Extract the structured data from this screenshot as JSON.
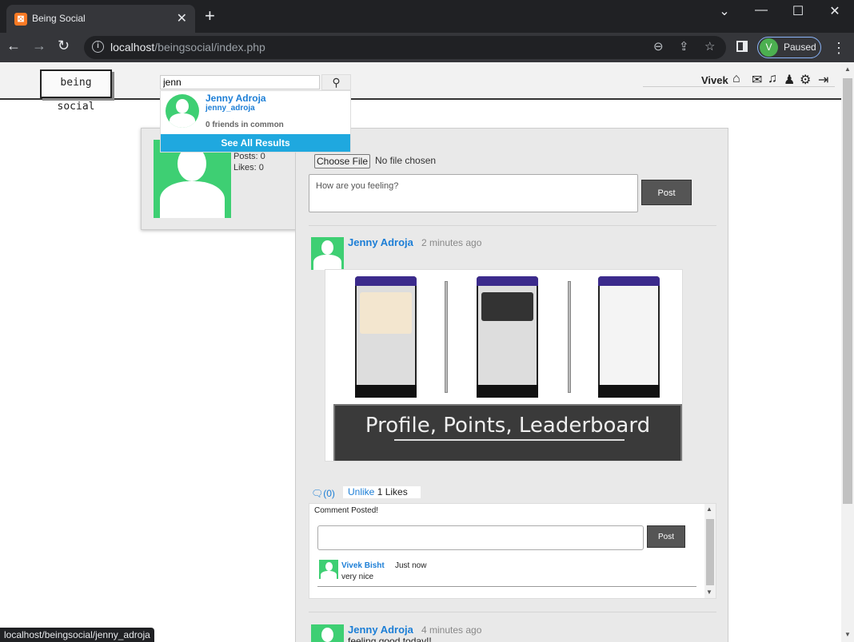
{
  "browser": {
    "tab_title": "Being Social",
    "url_host": "localhost",
    "url_path": "/beingsocial/index.php",
    "profile_initial": "V",
    "profile_status": "Paused",
    "status_url": "localhost/beingsocial/jenny_adroja"
  },
  "header": {
    "logo": "being social",
    "search_value": "jenn",
    "username": "Vivek"
  },
  "search_result": {
    "name": "Jenny Adroja",
    "username": "jenny_adroja",
    "mutual": "0 friends in common",
    "see_all": "See All Results"
  },
  "profile_card": {
    "posts": "Posts: 0",
    "likes": "Likes: 0"
  },
  "composer": {
    "file_button": "Choose File",
    "file_status": "No file chosen",
    "placeholder": "How are you feeling?",
    "post_label": "Post"
  },
  "post1": {
    "author": "Jenny Adroja",
    "time": "2 minutes ago",
    "image_caption": "Profile, Points, Leaderboard",
    "comments_link": "(0)",
    "unlike": "Unlike",
    "likes": "1 Likes",
    "comment_status": "Comment Posted!",
    "comment_post_label": "Post",
    "comment": {
      "author": "Vivek Bisht",
      "time": "Just now",
      "text": "very nice"
    }
  },
  "post2": {
    "author": "Jenny Adroja",
    "time": "4 minutes ago",
    "text": "feeling good today!!"
  },
  "colors": {
    "accent": "#1c7ed6",
    "avatar": "#3ecf73",
    "see_all_bg": "#1fa8df"
  }
}
